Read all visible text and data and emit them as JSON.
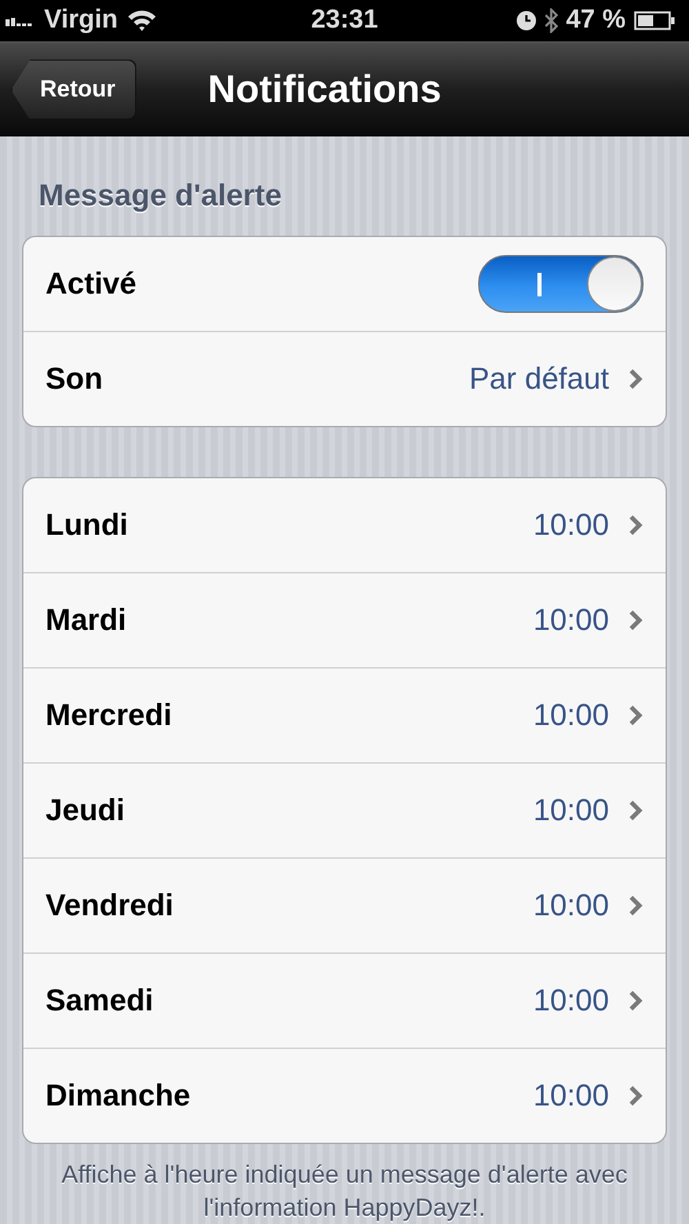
{
  "status_bar": {
    "carrier": "Virgin",
    "time": "23:31",
    "battery": "47 %"
  },
  "nav_bar": {
    "back": "Retour",
    "title": "Notifications"
  },
  "sections": [
    {
      "header": "Message d'alerte",
      "rows": [
        {
          "kind": "toggle",
          "label": "Activé",
          "on": true
        },
        {
          "kind": "link",
          "label": "Son",
          "value": "Par défaut"
        }
      ]
    },
    {
      "rows": [
        {
          "kind": "link",
          "label": "Lundi",
          "value": "10:00"
        },
        {
          "kind": "link",
          "label": "Mardi",
          "value": "10:00"
        },
        {
          "kind": "link",
          "label": "Mercredi",
          "value": "10:00"
        },
        {
          "kind": "link",
          "label": "Jeudi",
          "value": "10:00"
        },
        {
          "kind": "link",
          "label": "Vendredi",
          "value": "10:00"
        },
        {
          "kind": "link",
          "label": "Samedi",
          "value": "10:00"
        },
        {
          "kind": "link",
          "label": "Dimanche",
          "value": "10:00"
        }
      ],
      "footer": "Affiche à l'heure indiquée un message d'alerte avec l'information HappyDayz!."
    }
  ]
}
